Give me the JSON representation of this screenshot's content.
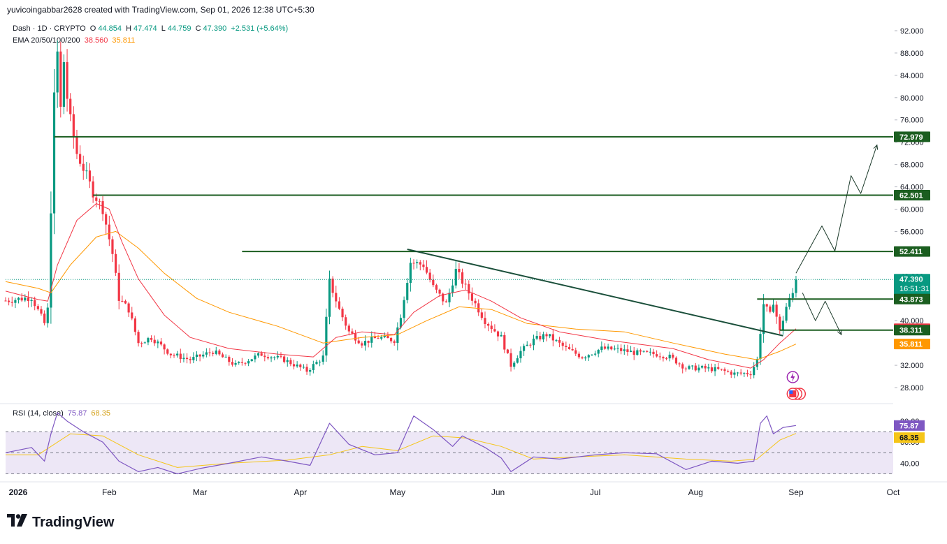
{
  "header": {
    "text": "yuvicoingabbar2628 created with TradingView.com, Sep 01, 2026 12:38 UTC+5:30"
  },
  "legend": {
    "symbol": "Dash · 1D · CRYPTO",
    "o_label": "O",
    "o": "44.854",
    "h_label": "H",
    "h": "47.474",
    "l_label": "L",
    "l": "44.759",
    "c_label": "C",
    "c": "47.390",
    "change": "+2.531 (+5.64%)",
    "ema_label": "EMA 20/50/100/200",
    "ema20": "38.560",
    "ema50": "35.811",
    "rsi_label": "RSI (14, close)",
    "rsi": "75.87",
    "rsi_ma": "68.35"
  },
  "brand": {
    "name": "TradingView"
  },
  "colors": {
    "up": "#089981",
    "down": "#f23645",
    "ema20": "#f23645",
    "ema50": "#ff9800",
    "level": "#1b5e20",
    "rsi": "#7e57c2",
    "rsi_ma": "#f5c518",
    "rsi_band": "#ede7f6"
  },
  "chart_data": {
    "type": "candlestick",
    "symbol": "Dash",
    "interval": "1D",
    "y_ticks": [
      "92.000",
      "88.000",
      "84.000",
      "80.000",
      "76.000",
      "72.000",
      "68.000",
      "64.000",
      "60.000",
      "56.000",
      "52.000",
      "48.000",
      "44.000",
      "40.000",
      "36.000",
      "32.000",
      "28.000"
    ],
    "y_range": [
      25.5,
      93.5
    ],
    "x_labels": [
      "2026",
      "Feb",
      "Mar",
      "Apr",
      "May",
      "Jun",
      "Jul",
      "Aug",
      "Sep",
      "Oct"
    ],
    "x_dates": [
      "2026-01-01",
      "2026-02-01",
      "2026-03-01",
      "2026-04-01",
      "2026-05-01",
      "2026-06-01",
      "2026-07-01",
      "2026-08-01",
      "2026-09-01",
      "2026-10-01"
    ],
    "x_range": [
      "2025-12-31",
      "2026-10-01"
    ],
    "price_points": [
      [
        "2025-12-31",
        43.6
      ],
      [
        "2026-01-08",
        44.2
      ],
      [
        "2026-01-12",
        39.5
      ],
      [
        "2026-01-13",
        42.0
      ],
      [
        "2026-01-14",
        60.0
      ],
      [
        "2026-01-15",
        80.0
      ],
      [
        "2026-01-16",
        88.0
      ],
      [
        "2026-01-17",
        78.0
      ],
      [
        "2026-01-18",
        86.5
      ],
      [
        "2026-01-19",
        80.0
      ],
      [
        "2026-01-20",
        76.0
      ],
      [
        "2026-01-22",
        70.0
      ],
      [
        "2026-01-25",
        66.0
      ],
      [
        "2026-01-27",
        63.0
      ],
      [
        "2026-01-30",
        60.0
      ],
      [
        "2026-02-02",
        52.0
      ],
      [
        "2026-02-04",
        44.0
      ],
      [
        "2026-02-07",
        42.0
      ],
      [
        "2026-02-10",
        36.0
      ],
      [
        "2026-02-14",
        37.0
      ],
      [
        "2026-02-20",
        34.0
      ],
      [
        "2026-02-26",
        33.0
      ],
      [
        "2026-03-05",
        34.5
      ],
      [
        "2026-03-12",
        32.0
      ],
      [
        "2026-03-20",
        34.0
      ],
      [
        "2026-03-27",
        33.0
      ],
      [
        "2026-04-03",
        31.0
      ],
      [
        "2026-04-08",
        33.5
      ],
      [
        "2026-04-10",
        47.0
      ],
      [
        "2026-04-13",
        42.0
      ],
      [
        "2026-04-16",
        38.0
      ],
      [
        "2026-04-20",
        36.0
      ],
      [
        "2026-04-25",
        37.0
      ],
      [
        "2026-04-30",
        36.5
      ],
      [
        "2026-05-02",
        41.0
      ],
      [
        "2026-05-05",
        50.5
      ],
      [
        "2026-05-09",
        50.0
      ],
      [
        "2026-05-12",
        46.0
      ],
      [
        "2026-05-16",
        43.0
      ],
      [
        "2026-05-19",
        49.0
      ],
      [
        "2026-05-22",
        46.0
      ],
      [
        "2026-05-25",
        43.0
      ],
      [
        "2026-05-28",
        40.0
      ],
      [
        "2026-06-02",
        37.0
      ],
      [
        "2026-06-05",
        32.0
      ],
      [
        "2026-06-08",
        34.5
      ],
      [
        "2026-06-12",
        36.5
      ],
      [
        "2026-06-16",
        37.5
      ],
      [
        "2026-06-22",
        35.0
      ],
      [
        "2026-06-27",
        33.5
      ],
      [
        "2026-07-03",
        35.0
      ],
      [
        "2026-07-08",
        34.8
      ],
      [
        "2026-07-14",
        34.2
      ],
      [
        "2026-07-20",
        34.0
      ],
      [
        "2026-07-24",
        33.5
      ],
      [
        "2026-07-29",
        31.5
      ],
      [
        "2026-08-03",
        31.5
      ],
      [
        "2026-08-08",
        31.2
      ],
      [
        "2026-08-13",
        30.5
      ],
      [
        "2026-08-18",
        30.6
      ],
      [
        "2026-08-20",
        33.0
      ],
      [
        "2026-08-22",
        43.0
      ],
      [
        "2026-08-24",
        41.0
      ],
      [
        "2026-08-25",
        43.5
      ],
      [
        "2026-08-27",
        38.0
      ],
      [
        "2026-08-29",
        42.5
      ],
      [
        "2026-08-31",
        44.9
      ],
      [
        "2026-09-01",
        47.39
      ]
    ],
    "ema20": [
      [
        "2025-12-31",
        45.3
      ],
      [
        "2026-01-10",
        43.8
      ],
      [
        "2026-01-13",
        43.5
      ],
      [
        "2026-01-16",
        50.0
      ],
      [
        "2026-01-22",
        58.0
      ],
      [
        "2026-01-28",
        61.0
      ],
      [
        "2026-02-01",
        60.0
      ],
      [
        "2026-02-05",
        54.0
      ],
      [
        "2026-02-10",
        47.5
      ],
      [
        "2026-02-18",
        41.0
      ],
      [
        "2026-02-26",
        37.0
      ],
      [
        "2026-03-10",
        35.0
      ],
      [
        "2026-03-25",
        34.0
      ],
      [
        "2026-04-05",
        33.5
      ],
      [
        "2026-04-12",
        37.0
      ],
      [
        "2026-04-20",
        38.0
      ],
      [
        "2026-04-30",
        37.5
      ],
      [
        "2026-05-06",
        41.5
      ],
      [
        "2026-05-14",
        44.5
      ],
      [
        "2026-05-22",
        45.5
      ],
      [
        "2026-05-30",
        43.5
      ],
      [
        "2026-06-08",
        40.5
      ],
      [
        "2026-06-20",
        38.0
      ],
      [
        "2026-07-05",
        36.5
      ],
      [
        "2026-07-25",
        35.0
      ],
      [
        "2026-08-05",
        33.0
      ],
      [
        "2026-08-18",
        31.5
      ],
      [
        "2026-08-22",
        33.0
      ],
      [
        "2026-08-27",
        36.0
      ],
      [
        "2026-09-01",
        38.56
      ]
    ],
    "ema50": [
      [
        "2025-12-31",
        47.0
      ],
      [
        "2026-01-10",
        45.8
      ],
      [
        "2026-01-14",
        45.0
      ],
      [
        "2026-01-20",
        50.0
      ],
      [
        "2026-01-28",
        55.0
      ],
      [
        "2026-02-03",
        56.0
      ],
      [
        "2026-02-10",
        53.0
      ],
      [
        "2026-02-18",
        48.5
      ],
      [
        "2026-02-28",
        44.0
      ],
      [
        "2026-03-10",
        41.5
      ],
      [
        "2026-03-25",
        39.0
      ],
      [
        "2026-04-08",
        36.0
      ],
      [
        "2026-04-20",
        37.0
      ],
      [
        "2026-05-01",
        37.5
      ],
      [
        "2026-05-10",
        40.0
      ],
      [
        "2026-05-20",
        42.5
      ],
      [
        "2026-05-30",
        42.0
      ],
      [
        "2026-06-10",
        39.5
      ],
      [
        "2026-06-25",
        38.5
      ],
      [
        "2026-07-10",
        38.0
      ],
      [
        "2026-07-25",
        36.0
      ],
      [
        "2026-08-10",
        34.0
      ],
      [
        "2026-08-20",
        33.0
      ],
      [
        "2026-08-27",
        34.5
      ],
      [
        "2026-09-01",
        35.811
      ]
    ],
    "levels": [
      {
        "value": 72.979,
        "label": "72.979",
        "from": "2026-01-15"
      },
      {
        "value": 62.501,
        "label": "62.501",
        "from": "2026-01-27"
      },
      {
        "value": 52.411,
        "label": "52.411",
        "from": "2026-03-14"
      },
      {
        "value": 43.873,
        "label": "43.873",
        "from": "2026-08-20"
      },
      {
        "value": 38.311,
        "label": "38.311",
        "from": "2026-08-27"
      }
    ],
    "trendline": [
      [
        "2026-05-04",
        52.8
      ],
      [
        "2026-08-28",
        37.3
      ]
    ],
    "projection_up": [
      [
        "2026-09-01",
        48.5
      ],
      [
        "2026-09-09",
        57.0
      ],
      [
        "2026-09-13",
        52.5
      ],
      [
        "2026-09-18",
        66.0
      ],
      [
        "2026-09-21",
        62.8
      ],
      [
        "2026-09-26",
        71.5
      ]
    ],
    "projection_down": [
      [
        "2026-09-03",
        45.0
      ],
      [
        "2026-09-07",
        40.0
      ],
      [
        "2026-09-10",
        43.5
      ],
      [
        "2026-09-15",
        37.5
      ]
    ],
    "price_labels": [
      {
        "value": 72.979,
        "label": "72.979",
        "color": "#1b5e20"
      },
      {
        "value": 62.501,
        "label": "62.501",
        "color": "#1b5e20"
      },
      {
        "value": 52.411,
        "label": "52.411",
        "color": "#1b5e20"
      },
      {
        "value": 47.39,
        "label": "47.390",
        "sublabel": "16:51:31",
        "color": "#089981"
      },
      {
        "value": 43.873,
        "label": "43.873",
        "color": "#1b5e20"
      },
      {
        "value": 38.56,
        "label": "38.560",
        "color": "#f23645"
      },
      {
        "value": 38.311,
        "label": "38.311",
        "color": "#1b5e20"
      },
      {
        "value": 35.811,
        "label": "35.811",
        "color": "#ff9800"
      }
    ],
    "rsi": {
      "y_ticks": [
        "80.00",
        "60.00",
        "40.00"
      ],
      "y_range": [
        25,
        92
      ],
      "overbought": 70,
      "middle": 50,
      "oversold": 30,
      "values": [
        [
          "2025-12-31",
          50
        ],
        [
          "2026-01-08",
          55
        ],
        [
          "2026-01-12",
          42
        ],
        [
          "2026-01-14",
          68
        ],
        [
          "2026-01-16",
          88
        ],
        [
          "2026-01-19",
          80
        ],
        [
          "2026-01-24",
          70
        ],
        [
          "2026-01-30",
          60
        ],
        [
          "2026-02-04",
          42
        ],
        [
          "2026-02-10",
          32
        ],
        [
          "2026-02-16",
          36
        ],
        [
          "2026-02-22",
          30
        ],
        [
          "2026-03-01",
          35
        ],
        [
          "2026-03-10",
          40
        ],
        [
          "2026-03-20",
          46
        ],
        [
          "2026-03-28",
          42
        ],
        [
          "2026-04-04",
          38
        ],
        [
          "2026-04-10",
          78
        ],
        [
          "2026-04-16",
          58
        ],
        [
          "2026-04-24",
          48
        ],
        [
          "2026-05-01",
          50
        ],
        [
          "2026-05-06",
          85
        ],
        [
          "2026-05-12",
          72
        ],
        [
          "2026-05-18",
          56
        ],
        [
          "2026-05-21",
          66
        ],
        [
          "2026-05-28",
          55
        ],
        [
          "2026-06-02",
          45
        ],
        [
          "2026-06-05",
          32
        ],
        [
          "2026-06-12",
          46
        ],
        [
          "2026-06-20",
          44
        ],
        [
          "2026-07-01",
          48
        ],
        [
          "2026-07-10",
          50
        ],
        [
          "2026-07-20",
          49
        ],
        [
          "2026-07-29",
          34
        ],
        [
          "2026-08-06",
          42
        ],
        [
          "2026-08-14",
          40
        ],
        [
          "2026-08-19",
          42
        ],
        [
          "2026-08-21",
          78
        ],
        [
          "2026-08-23",
          85
        ],
        [
          "2026-08-25",
          68
        ],
        [
          "2026-08-28",
          74
        ],
        [
          "2026-09-01",
          75.87
        ]
      ],
      "ma": [
        [
          "2025-12-31",
          48
        ],
        [
          "2026-01-10",
          48
        ],
        [
          "2026-01-20",
          68
        ],
        [
          "2026-01-30",
          66
        ],
        [
          "2026-02-10",
          48
        ],
        [
          "2026-02-22",
          36
        ],
        [
          "2026-03-10",
          40
        ],
        [
          "2026-03-28",
          43
        ],
        [
          "2026-04-10",
          48
        ],
        [
          "2026-04-20",
          56
        ],
        [
          "2026-05-01",
          52
        ],
        [
          "2026-05-12",
          66
        ],
        [
          "2026-05-22",
          64
        ],
        [
          "2026-06-02",
          56
        ],
        [
          "2026-06-12",
          44
        ],
        [
          "2026-06-25",
          46
        ],
        [
          "2026-07-10",
          48
        ],
        [
          "2026-07-29",
          44
        ],
        [
          "2026-08-12",
          42
        ],
        [
          "2026-08-20",
          44
        ],
        [
          "2026-08-27",
          62
        ],
        [
          "2026-09-01",
          68.35
        ]
      ]
    }
  }
}
